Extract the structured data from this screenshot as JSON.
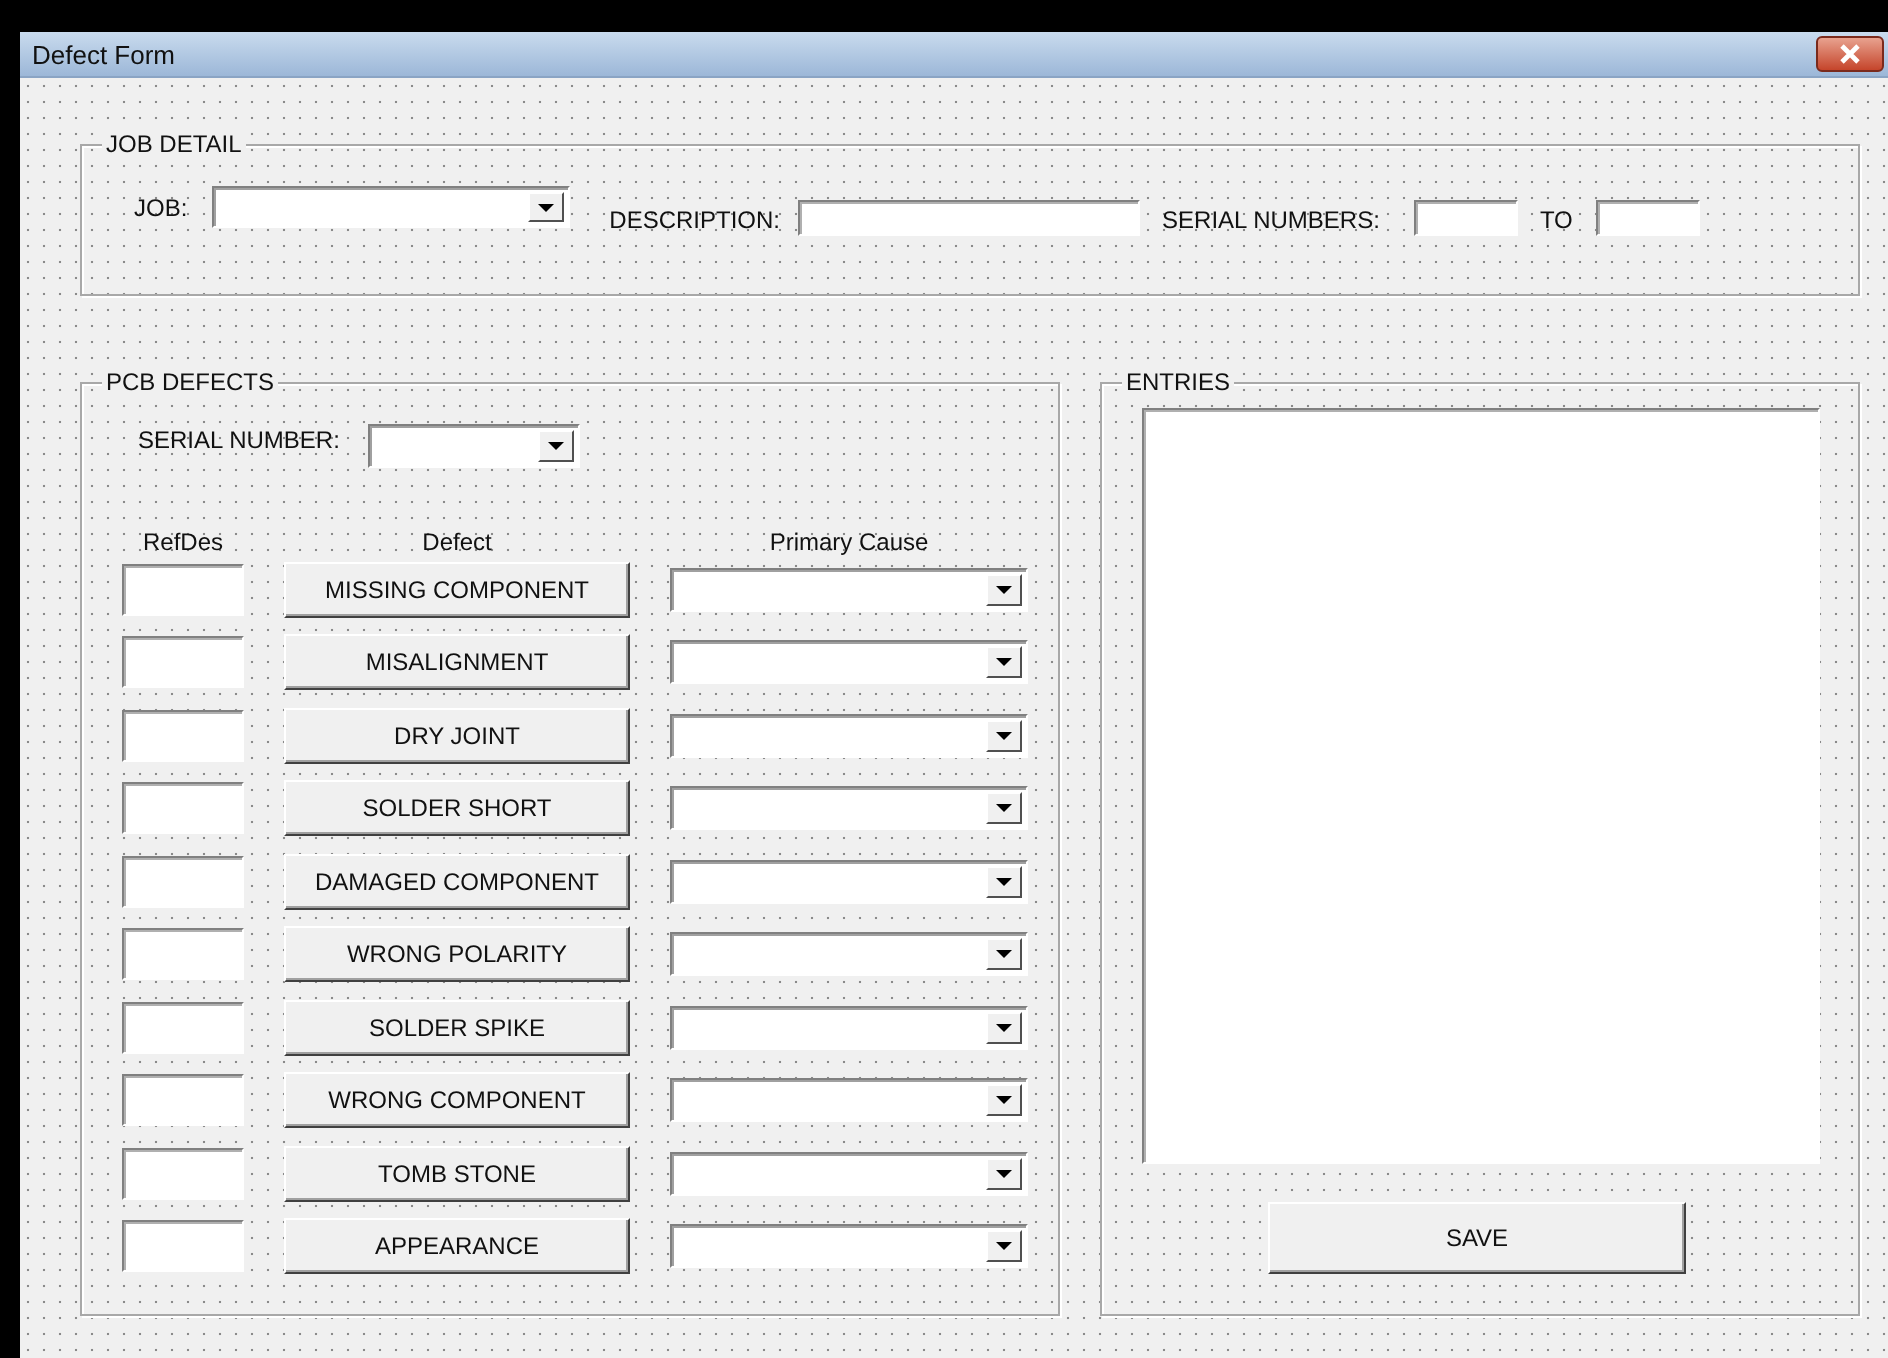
{
  "window": {
    "title": "Defect Form"
  },
  "job_detail": {
    "title": "JOB DETAIL",
    "job_label": "JOB:",
    "description_label": "DESCRIPTION:",
    "serial_numbers_label": "SERIAL NUMBERS:",
    "to_label": "TO"
  },
  "pcb_defects": {
    "title": "PCB DEFECTS",
    "serial_number_label": "SERIAL NUMBER:",
    "columns": [
      "RefDes",
      "Defect",
      "Primary Cause"
    ],
    "defects": [
      "MISSING COMPONENT",
      "MISALIGNMENT",
      "DRY JOINT",
      "SOLDER SHORT",
      "DAMAGED COMPONENT",
      "WRONG POLARITY",
      "SOLDER SPIKE",
      "WRONG COMPONENT",
      "TOMB STONE",
      "APPEARANCE"
    ]
  },
  "entries": {
    "title": "ENTRIES"
  },
  "save_button": "SAVE"
}
